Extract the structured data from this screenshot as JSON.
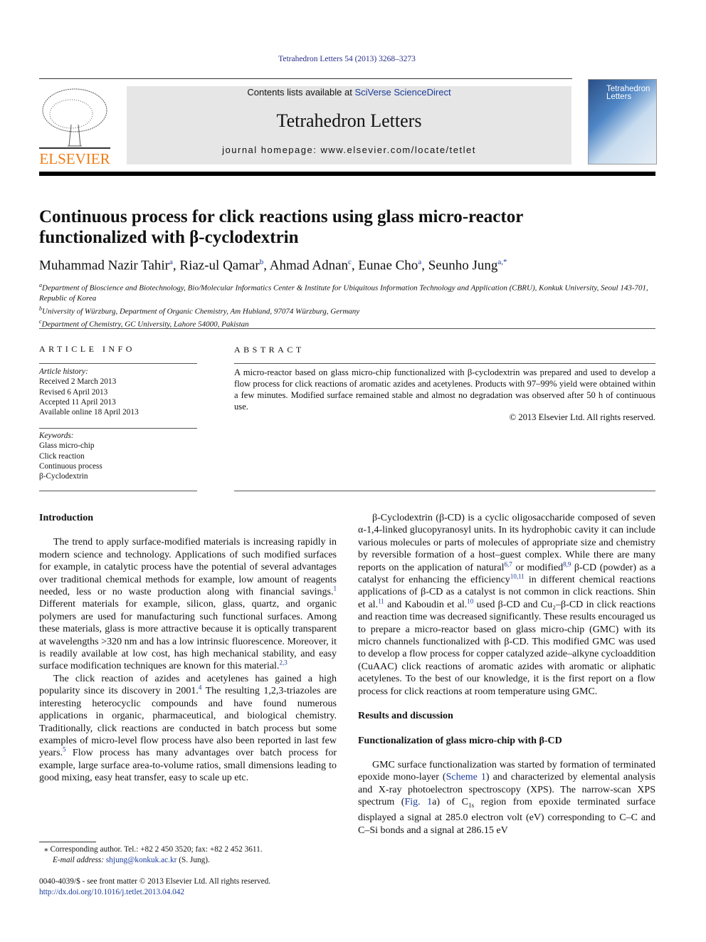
{
  "header": {
    "citation": "Tetrahedron Letters 54 (2013) 3268–3273",
    "contents_prefix": "Contents lists available at ",
    "contents_link": "SciVerse ScienceDirect",
    "journal_title": "Tetrahedron Letters",
    "homepage": "journal homepage: www.elsevier.com/locate/tetlet",
    "publisher": "ELSEVIER",
    "cover_title": "Tetrahedron Letters"
  },
  "article": {
    "title": "Continuous process for click reactions using glass micro-reactor functionalized with β-cyclodextrin",
    "authors": [
      {
        "name": "Muhammad Nazir Tahir",
        "sup": "a"
      },
      {
        "name": "Riaz-ul Qamar",
        "sup": "b"
      },
      {
        "name": "Ahmad Adnan",
        "sup": "c"
      },
      {
        "name": "Eunae Cho",
        "sup": "a"
      },
      {
        "name": "Seunho Jung",
        "sup": "a,*"
      }
    ],
    "affiliations": [
      {
        "sup": "a",
        "text": "Department of Bioscience and Biotechnology, Bio/Molecular Informatics Center & Institute for Ubiquitous Information Technology and Application (CBRU), Konkuk University, Seoul 143-701, Republic of Korea"
      },
      {
        "sup": "b",
        "text": "University of Würzburg, Department of Organic Chemistry, Am Hubland, 97074 Würzburg, Germany"
      },
      {
        "sup": "c",
        "text": "Department of Chemistry, GC University, Lahore 54000, Pakistan"
      }
    ]
  },
  "info": {
    "heading": "ARTICLE INFO",
    "history_label": "Article history:",
    "history": [
      "Received 2 March 2013",
      "Revised 6 April 2013",
      "Accepted 11 April 2013",
      "Available online 18 April 2013"
    ],
    "keywords_label": "Keywords:",
    "keywords": [
      "Glass micro-chip",
      "Click reaction",
      "Continuous process",
      "β-Cyclodextrin"
    ]
  },
  "abstract": {
    "heading": "ABSTRACT",
    "text": "A micro-reactor based on glass micro-chip functionalized with β-cyclodextrin was prepared and used to develop a flow process for click reactions of aromatic azides and acetylenes. Products with 97–99% yield were obtained within a few minutes. Modified surface remained stable and almost no degradation was observed after 50 h of continuous use.",
    "copyright": "© 2013 Elsevier Ltd. All rights reserved."
  },
  "left_column": [
    {
      "type": "h",
      "text": "Introduction"
    },
    {
      "type": "p",
      "segs": [
        {
          "t": "The trend to apply surface-modified materials is increasing rapidly in modern science and technology. Applications of such modified surfaces for example, in catalytic process have the potential of several advantages over traditional chemical methods for example, low amount of reagents needed, less or no waste production along with financial savings."
        },
        {
          "s": "1"
        },
        {
          "t": " Different materials for example, silicon, glass, quartz, and organic polymers are used for manufacturing such functional surfaces. Among these materials, glass is more attractive because it is optically transparent at wavelengths >320 nm and has a low intrinsic fluorescence. Moreover, it is readily available at low cost, has high mechanical stability, and easy surface modification techniques are known for this material."
        },
        {
          "s": "2,3"
        }
      ]
    },
    {
      "type": "p",
      "segs": [
        {
          "t": "The click reaction of azides and acetylenes has gained a high popularity since its discovery in 2001."
        },
        {
          "s": "4"
        },
        {
          "t": " The resulting 1,2,3-triazoles are interesting heterocyclic compounds and have found numerous applications in organic, pharmaceutical, and biological chemistry. Traditionally, click reactions are conducted in batch process but some examples of micro-level flow process have also been reported in last few years."
        },
        {
          "s": "5"
        },
        {
          "t": " Flow process has many advantages over batch process for example, large surface area-to-volume ratios, small dimensions leading to good mixing, easy heat transfer, easy to scale up etc."
        }
      ]
    }
  ],
  "right_column": [
    {
      "type": "p",
      "segs": [
        {
          "t": "β-Cyclodextrin (β-CD) is a cyclic oligosaccharide composed of seven α-1,4-linked glucopyranosyl units. In its hydrophobic cavity it can include various molecules or parts of molecules of appropriate size and chemistry by reversible formation of a host–guest complex. While there are many reports on the application of natural"
        },
        {
          "s": "6,7"
        },
        {
          "t": " or modified"
        },
        {
          "s": "8,9"
        },
        {
          "t": " β-CD (powder) as a catalyst for enhancing the efficiency"
        },
        {
          "s": "10,11"
        },
        {
          "t": " in different chemical reactions applications of β-CD as a catalyst is not common in click reactions. Shin et al."
        },
        {
          "s": "11"
        },
        {
          "t": " and Kaboudin et al."
        },
        {
          "s": "10"
        },
        {
          "t": " used β-CD and Cu₂–β-CD in click reactions and reaction time was decreased significantly. These results encouraged us to prepare a micro-reactor based on glass micro-chip (GMC) with its micro channels functionalized with β-CD. This modified GMC was used to develop a flow process for copper catalyzed azide–alkyne cycloaddition (CuAAC) click reactions of aromatic azides with aromatic or aliphatic acetylenes. To the best of our knowledge, it is the first report on a flow process for click reactions at room temperature using GMC."
        }
      ]
    },
    {
      "type": "h",
      "text": "Results and discussion"
    },
    {
      "type": "h",
      "text": "Functionalization of glass micro-chip with β-CD"
    },
    {
      "type": "p",
      "segs": [
        {
          "t": "GMC surface functionalization was started by formation of terminated epoxide mono-layer ("
        },
        {
          "l": "Scheme 1"
        },
        {
          "t": ") and characterized by elemental analysis and X-ray photoelectron spectroscopy (XPS). The narrow-scan XPS spectrum ("
        },
        {
          "l": "Fig. 1"
        },
        {
          "t": "a) of C"
        },
        {
          "sub": "1s"
        },
        {
          "t": " region from epoxide terminated surface displayed a signal at 285.0 electron volt (eV) corresponding to C–C and C–Si bonds and a signal at 286.15 eV"
        }
      ]
    }
  ],
  "footnotes": {
    "corresponding": "⁎ Corresponding author. Tel.: +82 2 450 3520; fax: +82 2 452 3611.",
    "email_label": "E-mail address: ",
    "email": "shjung@konkuk.ac.kr",
    "email_suffix": " (S. Jung).",
    "issn": "0040-4039/$ - see front matter © 2013 Elsevier Ltd. All rights reserved.",
    "doi": "http://dx.doi.org/10.1016/j.tetlet.2013.04.042"
  },
  "colors": {
    "link": "#1a3a9a",
    "elsevier_orange": "#f07b14",
    "masthead_bg": "#e6e6e6"
  }
}
